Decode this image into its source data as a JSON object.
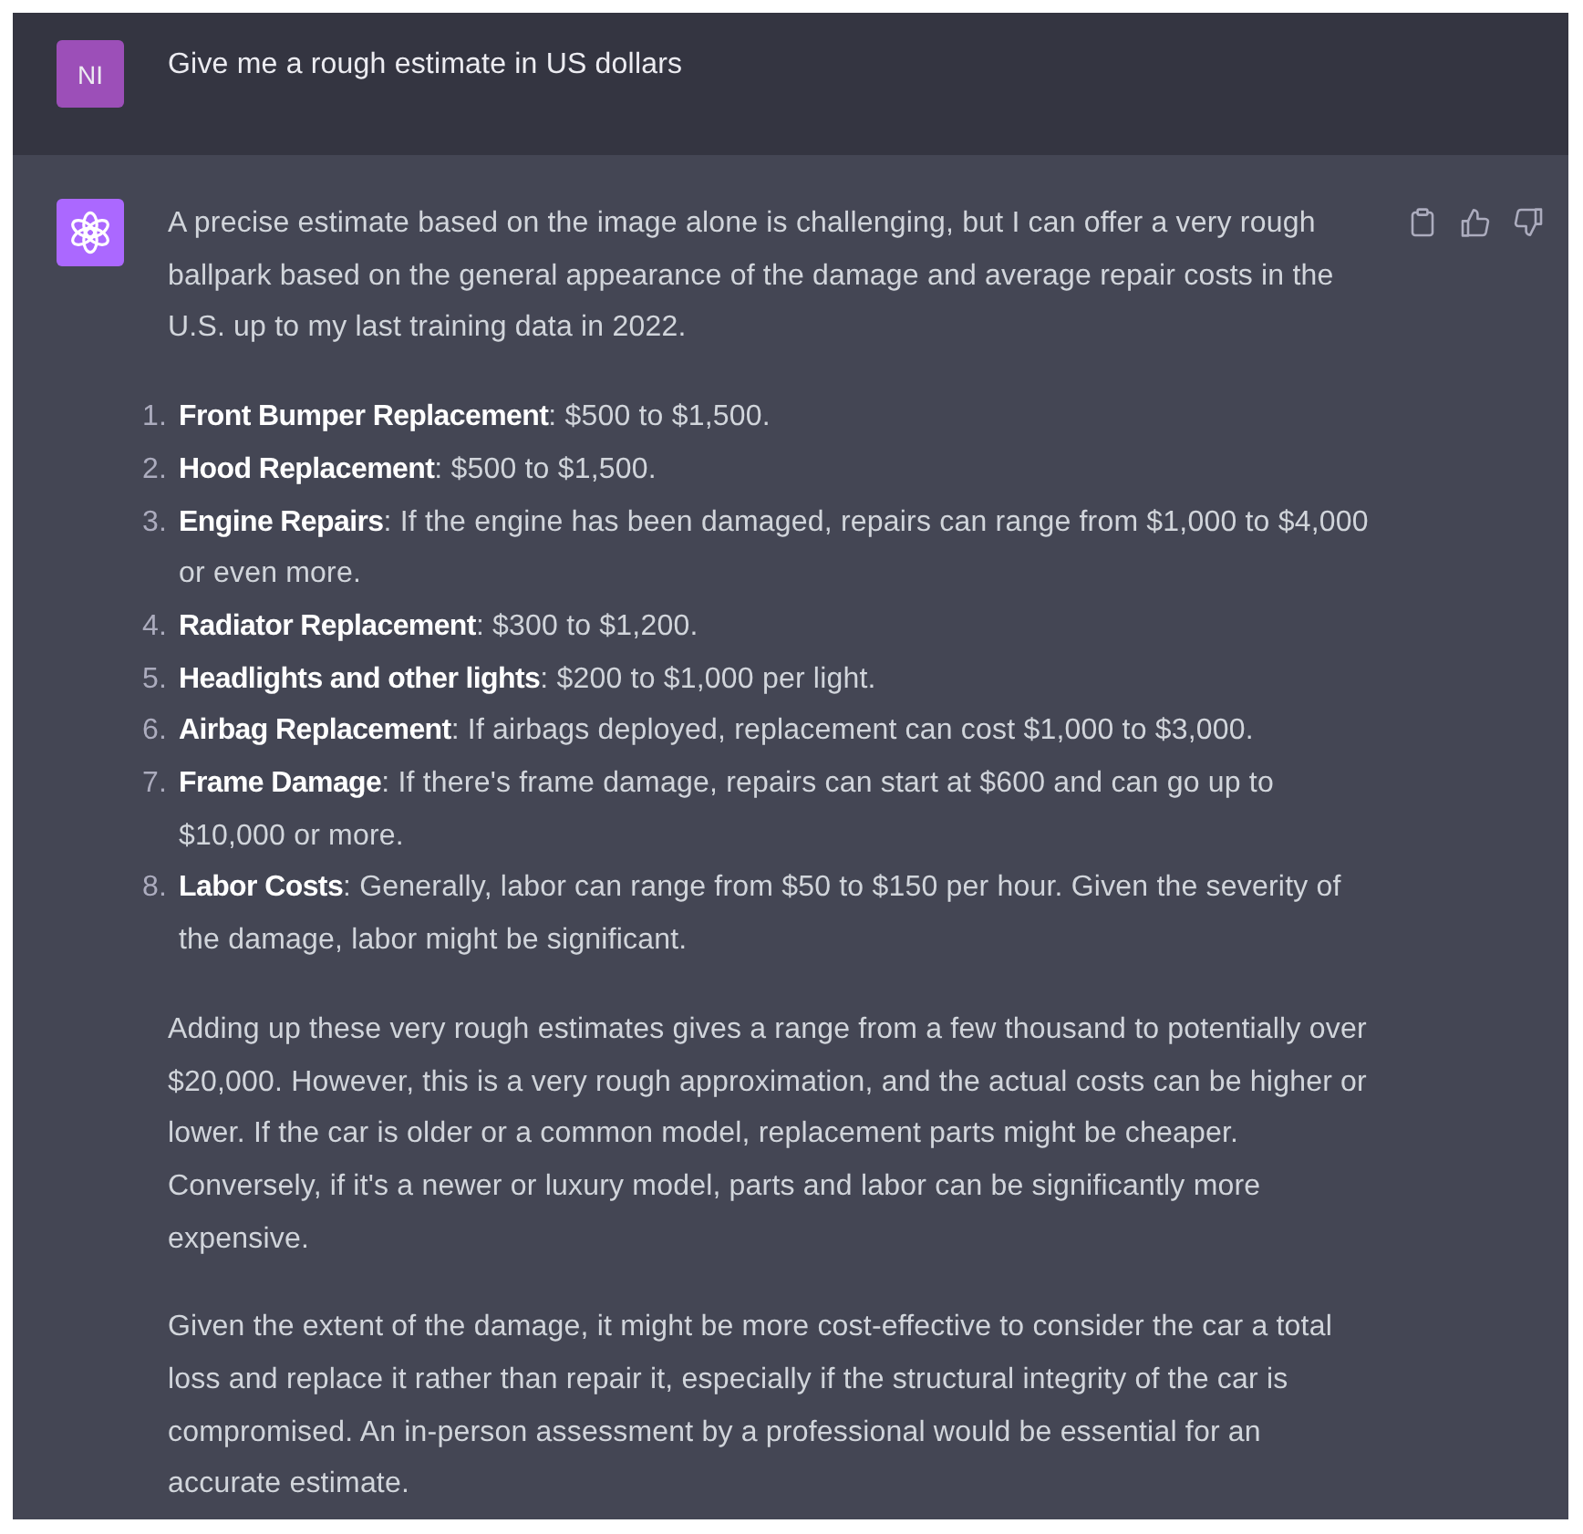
{
  "conversation": [
    {
      "kind": "user",
      "avatar": "NI",
      "text": "Give me a rough estimate in US dollars"
    },
    {
      "kind": "assistant",
      "blocks": [
        {
          "kind": "paragraph",
          "text": "A precise estimate based on the image alone is challenging, but I can offer a very rough ballpark based on the general appearance of the damage and average repair costs in the U.S. up to my last training data in 2022."
        },
        {
          "kind": "list",
          "items": [
            {
              "number": "1.",
              "text": "**Front Bumper Replacement**: $500 to $1,500."
            },
            {
              "number": "2.",
              "text": "**Hood Replacement**: $500 to $1,500."
            },
            {
              "number": "3.",
              "text": "**Engine Repairs**: If the engine has been damaged, repairs can range from $1,000 to $4,000 or even more."
            },
            {
              "number": "4.",
              "text": "**Radiator Replacement**: $300 to $1,200."
            },
            {
              "number": "5.",
              "text": "**Headlights and other lights**: $200 to $1,000 per light."
            },
            {
              "number": "6.",
              "text": "**Airbag Replacement**: If airbags deployed, replacement can cost $1,000 to $3,000."
            },
            {
              "number": "7.",
              "text": "**Frame Damage**: If there's frame damage, repairs can start at $600 and can go up to $10,000 or more."
            },
            {
              "number": "8.",
              "text": "**Labor Costs**: Generally, labor can range from $50 to $150 per hour. Given the severity of the damage, labor might be significant."
            }
          ]
        },
        {
          "kind": "paragraph",
          "text": "Adding up these very rough estimates gives a range from a few thousand to potentially over $20,000. However, this is a very rough approximation, and the actual costs can be higher or lower. If the car is older or a common model, replacement parts might be cheaper. Conversely, if it's a newer or luxury model, parts and labor can be significantly more expensive."
        },
        {
          "kind": "paragraph",
          "text": "Given the extent of the damage, it might be more cost-effective to consider the car a total loss and replace it rather than repair it, especially if the structural integrity of the car is compromised. An in-person assessment by a professional would be essential for an accurate estimate."
        }
      ]
    }
  ]
}
